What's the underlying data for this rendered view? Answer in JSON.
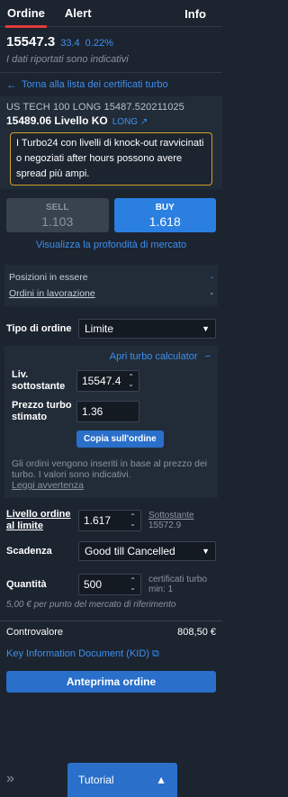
{
  "tabs": {
    "order": "Ordine",
    "alert": "Alert",
    "info": "Info"
  },
  "quote": {
    "price": "15547.3",
    "change": "33.4",
    "change_pct": "0.22%",
    "disclaimer": "I dati riportati sono indicativi"
  },
  "nav": {
    "back_label": "Torna alla lista dei certificati turbo"
  },
  "certificate": {
    "code": "US TECH 100 LONG 15487.520211025",
    "level": "15489.06 Livello KO",
    "direction": "LONG",
    "warning": "I Turbo24 con livelli di knock-out ravvicinati o negoziati after hours possono avere spread più ampi."
  },
  "trade": {
    "sell_label": "SELL",
    "sell_value": "1.103",
    "buy_label": "BUY",
    "buy_value": "1.618",
    "depth_link": "Visualizza la profondità di mercato"
  },
  "positions": {
    "open_label": "Posizioni in essere",
    "open_value": "-",
    "working_label": "Ordini in lavorazione",
    "working_value": "-"
  },
  "order_type": {
    "label": "Tipo di ordine",
    "value": "Limite"
  },
  "calculator": {
    "toggle_label": "Apri turbo calculator",
    "underlying_label": "Liv. sottostante",
    "underlying_value": "15547.4",
    "price_label": "Prezzo turbo stimato",
    "price_value": "1.36",
    "copy_button": "Copia sull'ordine",
    "note": "Gli ordini vengono inseriti in base al prezzo dei turbo. I valori sono indicativi.",
    "read_warning": "Leggi avvertenza"
  },
  "limit": {
    "label": "Livello ordine al limite",
    "value": "1.617",
    "underlying_label": "Sottostante",
    "underlying_value": "15572.9"
  },
  "expiry": {
    "label": "Scadenza",
    "value": "Good till Cancelled"
  },
  "quantity": {
    "label": "Quantità",
    "value": "500",
    "unit": "certificati turbo",
    "min": "min: 1",
    "note": "5,00 € per punto del mercato di riferimento"
  },
  "total": {
    "label": "Controvalore",
    "value": "808,50 €"
  },
  "kid_link": "Key Information Document (KID)",
  "preview_button": "Anteprima ordine",
  "tutorial_button": "Tutorial",
  "colors": {
    "accent": "#2a7fe0",
    "link": "#3d8ff0",
    "warning_border": "#d3a12b",
    "active_tab": "#e03a3a"
  }
}
